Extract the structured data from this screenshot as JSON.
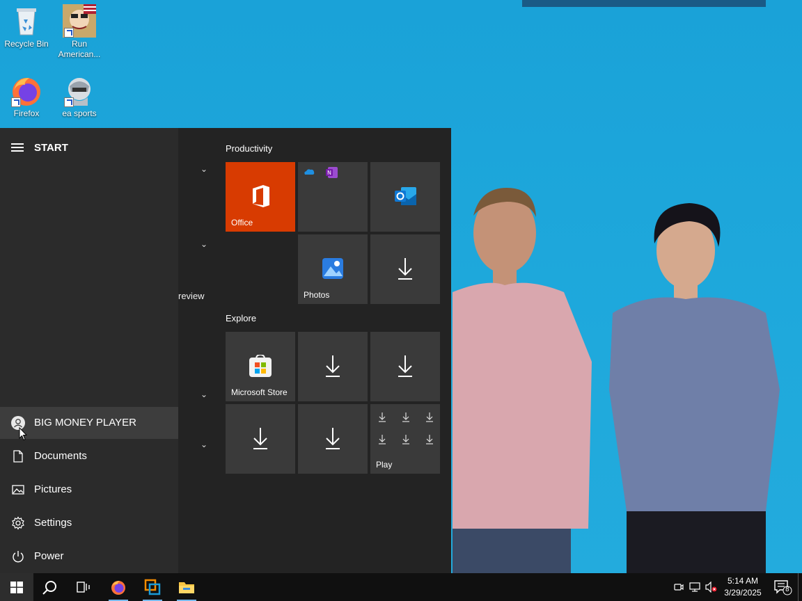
{
  "desktop": {
    "icons": [
      {
        "label": "Recycle Bin",
        "icon": "recycle-bin-icon"
      },
      {
        "label": "Run American...",
        "icon": "game-shortcut-icon"
      },
      {
        "label": "Firefox",
        "icon": "firefox-icon"
      },
      {
        "label": "ea sports",
        "icon": "ea-sports-icon"
      }
    ]
  },
  "start_menu": {
    "title": "START",
    "partial_label": "review",
    "user": {
      "name": "BIG MONEY PLAYER",
      "icon": "user-avatar-icon"
    },
    "items": [
      {
        "label": "Documents",
        "icon": "document-icon"
      },
      {
        "label": "Pictures",
        "icon": "pictures-icon"
      },
      {
        "label": "Settings",
        "icon": "gear-icon"
      },
      {
        "label": "Power",
        "icon": "power-icon"
      }
    ],
    "groups": [
      {
        "label": "Productivity"
      },
      {
        "label": "Explore"
      }
    ],
    "tiles": {
      "office": "Office",
      "photos": "Photos",
      "store": "Microsoft Store",
      "play": "Play"
    }
  },
  "taskbar": {
    "apps": [
      "windows-start-icon",
      "search-icon",
      "task-view-icon",
      "firefox-icon",
      "vmware-icon",
      "file-explorer-icon"
    ],
    "time": "5:14 AM",
    "date": "3/29/2025",
    "notifications_count": "8"
  },
  "colors": {
    "wallpaper": "#1ea7db",
    "start_bg": "#2b2b2b",
    "tile_bg": "#3a3a3a",
    "office_tile": "#d83b01",
    "taskbar": "#101010"
  }
}
